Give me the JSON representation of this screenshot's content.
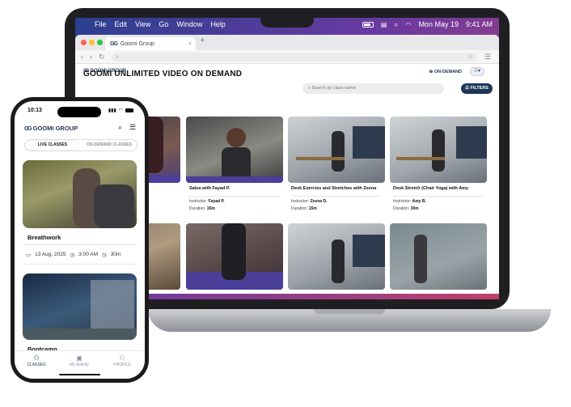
{
  "mac_menubar": {
    "apple": "",
    "items": [
      "File",
      "Edit",
      "View",
      "Go",
      "Window",
      "Help"
    ],
    "date": "Mon May 19",
    "time": "9:41 AM"
  },
  "browser": {
    "tab_title": "Goomi Group",
    "close": "×",
    "new_tab": "+"
  },
  "site": {
    "brand": "GOOMI GROUP",
    "ondemand_label": "ON-DEMAND",
    "page_title": "GOOMI UNLIMITED VIDEO ON DEMAND",
    "search_placeholder": "Search by class name",
    "filters_label": "FILTERS",
    "instructor_label": "Instructor:",
    "duration_label": "Duration:",
    "cards_row1": [
      {
        "title": "",
        "instructor": "",
        "duration": ""
      },
      {
        "title": "Salsa with Fayad P.",
        "instructor": "Fayad P.",
        "duration": "15m"
      },
      {
        "title": "Desk Exercies and Stretches with Zeena",
        "instructor": "Zeena D.",
        "duration": "15m"
      },
      {
        "title": "Desk Stretch (Chair Yoga) with Amy",
        "instructor": "Amy B.",
        "duration": "30m"
      }
    ]
  },
  "phone": {
    "time": "10:13",
    "brand": "GOOMI GROUP",
    "tab_live": "LIVE CLASSES",
    "tab_ondemand": "ON-DEMAND CLASSES",
    "class1": {
      "name": "Breathwork",
      "date": "13 Aug, 2025",
      "time": "3:00 AM",
      "duration": "30m"
    },
    "class2": {
      "name": "Bootcamp"
    },
    "nav": {
      "classes": "CLASSES",
      "activity": "My Activity",
      "profile": "PROFILE"
    }
  }
}
